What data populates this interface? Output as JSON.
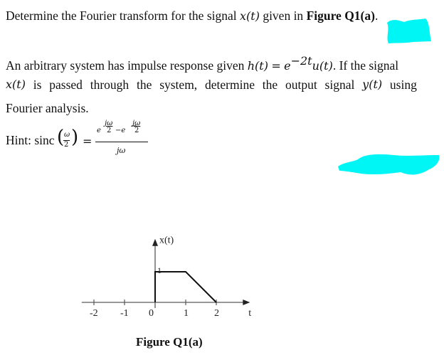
{
  "question": {
    "part1": {
      "text_before": "Determine the Fourier transform for the signal",
      "signal": "x(t)",
      "text_middle": "given in",
      "figure_ref": "Figure Q1(a)",
      "text_after": "."
    },
    "part2": {
      "line1_before": "An arbitrary system has impulse response given",
      "h_lhs": "h(t)",
      "equals": "=",
      "h_base": "e",
      "h_exponent": "−2t",
      "h_rest": "u(t)",
      "line1_after": ". If the signal",
      "line2_words": [
        "x(t)",
        "is",
        "passed",
        "through",
        "the",
        "system,",
        "determine",
        "the",
        "output",
        "signal",
        "y(t)",
        "using"
      ],
      "line3": "Fourier analysis."
    },
    "hint": {
      "label": "Hint: sinc",
      "arg_num": "ω",
      "arg_den": "2",
      "equals": "=",
      "num_term1_base": "e",
      "num_term1_exp_num": "jω",
      "num_term1_exp_den": "2",
      "minus": "−e",
      "num_term2_exp_num": "jω",
      "num_term2_exp_den": "2",
      "denominator": "jω"
    }
  },
  "figure": {
    "caption": "Figure Q1(a)",
    "colors": {
      "redaction": "#00f5f5",
      "axis": "#777777",
      "signal": "#111111"
    }
  },
  "chart_data": {
    "type": "line",
    "title": "Figure Q1(a)",
    "ylabel": "x(t)",
    "xlabel": "t",
    "x_ticks": [
      "-2",
      "-1",
      "0",
      "1",
      "2"
    ],
    "y_ticks": [
      "1"
    ],
    "xlim": [
      -2.4,
      3.1
    ],
    "ylim": [
      0,
      1.1
    ],
    "grid": false,
    "series": [
      {
        "name": "x(t)",
        "x": [
          0,
          0,
          1,
          2
        ],
        "y": [
          0,
          1,
          1,
          0
        ]
      }
    ]
  }
}
